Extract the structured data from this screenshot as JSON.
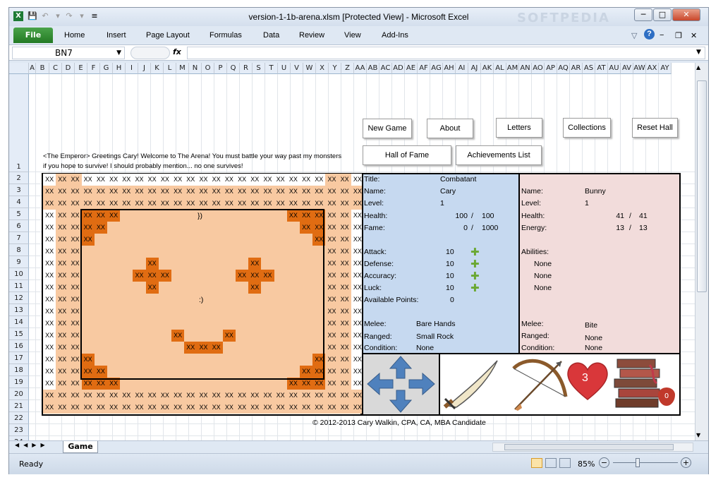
{
  "window": {
    "title": "version-1-1b-arena.xlsm  [Protected View]  -  Microsoft Excel",
    "watermark": "SOFTPEDIA",
    "min": "─",
    "max": "□",
    "close": "✕"
  },
  "ribbon": {
    "file": "File",
    "tabs": [
      "Home",
      "Insert",
      "Page Layout",
      "Formulas",
      "Data",
      "Review",
      "View",
      "Add-Ins"
    ]
  },
  "formula_bar": {
    "name_box": "BN7",
    "fx": "fx",
    "content": ""
  },
  "columns": [
    "A",
    "B",
    "C",
    "D",
    "E",
    "F",
    "G",
    "H",
    "I",
    "J",
    "K",
    "L",
    "M",
    "N",
    "O",
    "P",
    "Q",
    "R",
    "S",
    "T",
    "U",
    "V",
    "W",
    "X",
    "Y",
    "Z",
    "AA",
    "AB",
    "AC",
    "AD",
    "AE",
    "AF",
    "AG",
    "AH",
    "AI",
    "AJ",
    "AK",
    "AL",
    "AM",
    "AN",
    "AO",
    "AP",
    "AQ",
    "AR",
    "AS",
    "AT",
    "AU",
    "AV",
    "AW",
    "AX",
    "AY"
  ],
  "rows": [
    "1",
    "2",
    "3",
    "4",
    "5",
    "6",
    "7",
    "8",
    "9",
    "10",
    "11",
    "12",
    "13",
    "14",
    "15",
    "16",
    "17",
    "18",
    "19",
    "20",
    "21",
    "22",
    "23",
    "24"
  ],
  "buttons": {
    "new_game": "New Game",
    "about": "About",
    "letters": "Letters",
    "collections": "Collections",
    "reset_hall": "Reset Hall",
    "hall_of_fame": "Hall of Fame",
    "achievements": "Achievements List"
  },
  "emperor_message": {
    "line1": "<The Emperor> Greetings Cary! Welcome to The Arena! You must battle your way past my monsters",
    "line2": "if you hope to survive! I should probably mention... no one survives!"
  },
  "arena": {
    "cell_text": "XX",
    "top_symbol": "})",
    "mid_symbol": ":)"
  },
  "player": {
    "title_label": "Title:",
    "title": "Combatant",
    "name_label": "Name:",
    "name": "Cary",
    "level_label": "Level:",
    "level": "1",
    "health_label": "Health:",
    "health": "100",
    "health_max": "100",
    "fame_label": "Fame:",
    "fame": "0",
    "fame_max": "1000",
    "attack_label": "Attack:",
    "attack": "10",
    "defense_label": "Defense:",
    "defense": "10",
    "accuracy_label": "Accuracy:",
    "accuracy": "10",
    "luck_label": "Luck:",
    "luck": "10",
    "points_label": "Available Points:",
    "points": "0",
    "melee_label": "Melee:",
    "melee": "Bare Hands",
    "ranged_label": "Ranged:",
    "ranged": "Small Rock",
    "condition_label": "Condition:",
    "condition": "None",
    "slash": "/"
  },
  "enemy": {
    "name_label": "Name:",
    "name": "Bunny",
    "level_label": "Level:",
    "level": "1",
    "health_label": "Health:",
    "health": "41",
    "health_max": "41",
    "energy_label": "Energy:",
    "energy": "13",
    "energy_max": "13",
    "abilities_label": "Abilities:",
    "abilities": [
      "None",
      "None",
      "None"
    ],
    "melee_label": "Melee:",
    "melee": "Bite",
    "ranged_label": "Ranged:",
    "ranged": "None",
    "condition_label": "Condition:",
    "condition": "None"
  },
  "actions": {
    "potions": "3",
    "books": "0"
  },
  "copyright": "© 2012-2013 Cary Walkin, CPA, CA, MBA Candidate",
  "sheet_tab": "Game",
  "status": {
    "ready": "Ready",
    "zoom": "85%"
  },
  "colors": {
    "arena_light": "#f8c9a1",
    "arena_dark": "#e06c12",
    "player_panel": "#c6d9f0",
    "enemy_panel": "#f2dcdb",
    "control_panel": "#d9d9d9"
  }
}
